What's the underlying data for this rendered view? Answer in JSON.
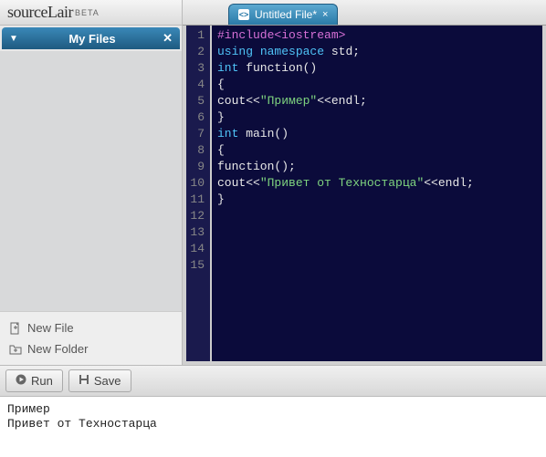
{
  "logo": {
    "main": "sourceLair",
    "beta": "BETA"
  },
  "sidebar": {
    "panel_title": "My Files",
    "new_file": "New File",
    "new_folder": "New Folder"
  },
  "tab": {
    "title": "Untitled File*",
    "close": "×"
  },
  "code_lines": [
    [
      {
        "c": "tok-pre",
        "t": "#include<iostream>"
      }
    ],
    [
      {
        "c": "tok-kw",
        "t": "using"
      },
      {
        "c": "tok-id",
        "t": " "
      },
      {
        "c": "tok-kw",
        "t": "namespace"
      },
      {
        "c": "tok-id",
        "t": " std;"
      }
    ],
    [
      {
        "c": "tok-kw",
        "t": "int"
      },
      {
        "c": "tok-id",
        "t": " function()"
      }
    ],
    [
      {
        "c": "tok-id",
        "t": "{"
      }
    ],
    [
      {
        "c": "tok-id",
        "t": "cout<<"
      },
      {
        "c": "tok-str",
        "t": "\"Пример\""
      },
      {
        "c": "tok-id",
        "t": "<<endl;"
      }
    ],
    [
      {
        "c": "tok-id",
        "t": "}"
      }
    ],
    [
      {
        "c": "tok-kw",
        "t": "int"
      },
      {
        "c": "tok-id",
        "t": " main()"
      }
    ],
    [
      {
        "c": "tok-id",
        "t": ""
      }
    ],
    [
      {
        "c": "tok-id",
        "t": "{"
      }
    ],
    [
      {
        "c": "tok-id",
        "t": ""
      }
    ],
    [
      {
        "c": "tok-id",
        "t": ""
      }
    ],
    [
      {
        "c": "tok-id",
        "t": "function();"
      }
    ],
    [
      {
        "c": "tok-id",
        "t": "cout<<"
      },
      {
        "c": "tok-str",
        "t": "\"Привет от Техностарца\""
      },
      {
        "c": "tok-id",
        "t": "<<endl;"
      }
    ],
    [
      {
        "c": "tok-id",
        "t": ""
      }
    ],
    [
      {
        "c": "tok-id",
        "t": "}"
      }
    ]
  ],
  "toolbar": {
    "run": "Run",
    "save": "Save"
  },
  "console_lines": [
    "Пример",
    "Привет от Техностарца"
  ]
}
